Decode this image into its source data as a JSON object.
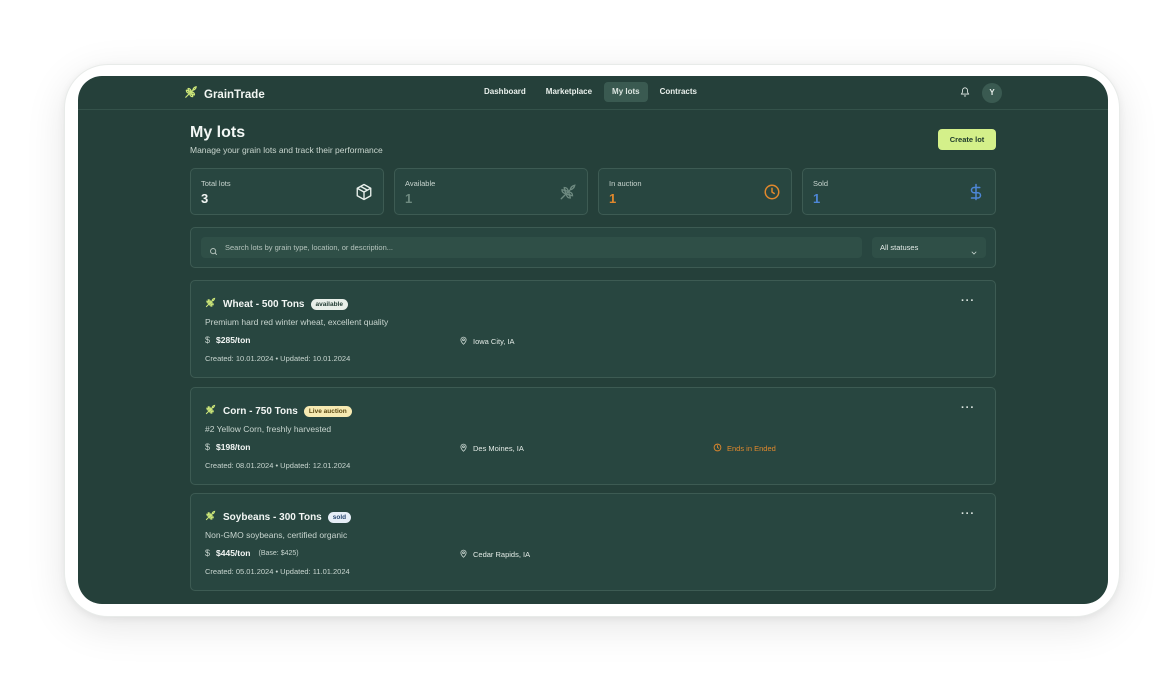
{
  "app": {
    "name": "GrainTrade"
  },
  "nav": {
    "links": [
      "Dashboard",
      "Marketplace",
      "My lots",
      "Contracts"
    ],
    "active": "My lots",
    "avatar_initial": "Y"
  },
  "header": {
    "title": "My lots",
    "subtitle": "Manage your grain lots and track their performance",
    "create_label": "Create lot"
  },
  "stats": [
    {
      "label": "Total lots",
      "value": "3",
      "icon": "box-icon",
      "color": "#f1f5f3"
    },
    {
      "label": "Available",
      "value": "1",
      "icon": "wheat-icon",
      "color": "#6e8a80"
    },
    {
      "label": "In auction",
      "value": "1",
      "icon": "clock-icon",
      "color": "#e0882c"
    },
    {
      "label": "Sold",
      "value": "1",
      "icon": "dollar-icon",
      "color": "#4d86d6"
    }
  ],
  "filters": {
    "search_placeholder": "Search lots by grain type, location, or description...",
    "status_value": "All statuses"
  },
  "lots": [
    {
      "title": "Wheat - 500 Tons",
      "badge": "available",
      "description": "Premium hard red winter wheat, excellent quality",
      "price": "$285/ton",
      "base": "",
      "location": "Iowa City, IA",
      "ends": "",
      "dates": "Created: 10.01.2024 • Updated: 10.01.2024"
    },
    {
      "title": "Corn - 750 Tons",
      "badge": "Live auction",
      "description": "#2 Yellow Corn, freshly harvested",
      "price": "$198/ton",
      "base": "",
      "location": "Des Moines, IA",
      "ends": "Ends in Ended",
      "dates": "Created: 08.01.2024 • Updated: 12.01.2024"
    },
    {
      "title": "Soybeans - 300 Tons",
      "badge": "sold",
      "description": "Non-GMO soybeans, certified organic",
      "price": "$445/ton",
      "base": "(Base: $425)",
      "location": "Cedar Rapids, IA",
      "ends": "",
      "dates": "Created: 05.01.2024 • Updated: 11.01.2024"
    }
  ],
  "colors": {
    "background": "#25403a",
    "accent": "#d4f08a",
    "auction": "#e0882c",
    "sold": "#4d86d6"
  }
}
